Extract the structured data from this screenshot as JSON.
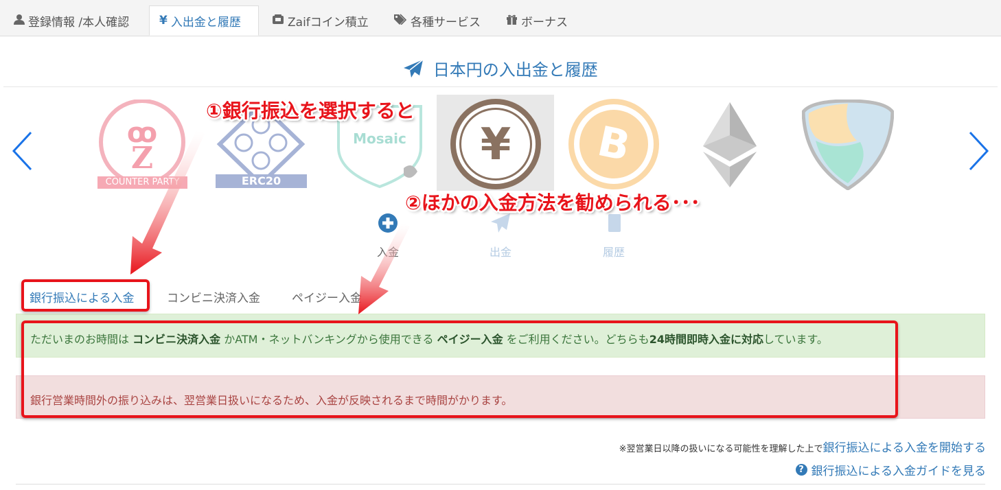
{
  "top_tabs": [
    {
      "label": "登録情報 /本人確認",
      "icon": "user-icon"
    },
    {
      "label": "入出金と履歴",
      "icon": "yen-icon",
      "active": true
    },
    {
      "label": "Zaifコイン積立",
      "icon": "piggy-icon"
    },
    {
      "label": "各種サービス",
      "icon": "tags-icon"
    },
    {
      "label": "ボーナス",
      "icon": "gift-icon"
    }
  ],
  "page_title": "日本円の入出金と履歴",
  "coins": {
    "counterparty_label": "COUNTER PARTY",
    "erc20_label": "ERC20",
    "mosaic_label": "Mosaic",
    "yen_symbol": "¥",
    "bitcoin_symbol": "B"
  },
  "actions": [
    {
      "label": "入金",
      "icon": "plus-circle-icon",
      "active": true
    },
    {
      "label": "出金",
      "icon": "paper-plane-icon"
    },
    {
      "label": "履歴",
      "icon": "book-icon"
    }
  ],
  "subtabs": [
    {
      "label": "銀行振込による入金",
      "active": true
    },
    {
      "label": "コンビニ決済入金"
    },
    {
      "label": "ペイジー入金"
    }
  ],
  "alert_green": {
    "p1": "ただいまのお時間は ",
    "b1": "コンビニ決済入金",
    "p2": " かATM・ネットバンキングから使用できる ",
    "b2": "ペイジー入金",
    "p3": " をご利用ください。どちらも",
    "b3": "24時間即時入金に対応",
    "p4": "しています。"
  },
  "alert_red": "銀行営業時間外の振り込みは、翌営業日扱いになるため、入金が反映されるまで時間がかります。",
  "notice_prefix": "※翌営業日以降の扱いになる可能性を理解した上で",
  "notice_link": "銀行振込による入金を開始する",
  "guide_link": "銀行振込による入金ガイドを見る",
  "annotations": {
    "step1": "①銀行振込を選択すると",
    "step2": "②ほかの入金方法を勧められる･･･"
  },
  "colors": {
    "accent": "#337ab7",
    "annotation_red": "#e8141b",
    "success_bg": "#dff0d8",
    "danger_bg": "#f2dede"
  }
}
